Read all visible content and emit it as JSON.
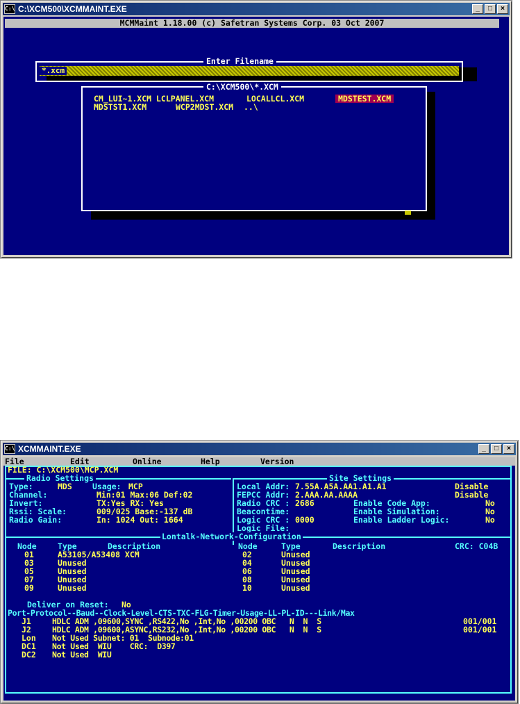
{
  "window1": {
    "title": "C:\\XCM500\\XCMMAINT.EXE",
    "icon_text": "C:\\",
    "header": "MCMMaint 1.18.00 (c) Safetran Systems Corp. 03 Oct 2007",
    "filename_dialog_title": "Enter Filename",
    "filename_input": "*.xcm",
    "filelist_title": "C:\\XCM500\\*.XCM",
    "files_row1": [
      "CM_LUI~1.XCM",
      "LCLPANEL.XCM",
      "LOCALLCL.XCM",
      "MDSTEST.XCM"
    ],
    "files_row2": [
      "MDSTST1.XCM",
      "WCP2MDST.XCM",
      "..\\"
    ]
  },
  "window2": {
    "title": "XCMMAINT.EXE",
    "icon_text": "C:\\",
    "menu": [
      "File",
      "Edit",
      "Online",
      "Help",
      "Version"
    ],
    "file_line": "FILE: C:\\XCM500\\MCP.XCM",
    "radio_title": "Radio Settings",
    "site_title": "Site Settings",
    "radio": {
      "type_label": "Type:",
      "type_value": "MDS",
      "usage_label": "Usage:",
      "usage_value": "MCP",
      "channel_label": "Channel:",
      "channel_value": "Min:01 Max:06 Def:02",
      "invert_label": "Invert:",
      "invert_value": "TX:Yes RX: Yes",
      "rssi_label": "Rssi: Scale:",
      "rssi_value": "009/025 Base:-137 dB",
      "gain_label": "Radio Gain:",
      "gain_value": "In: 1024 Out: 1664"
    },
    "site": {
      "local_label": "Local Addr:",
      "local_value": "7.55A.A5A.AA1.A1.A1",
      "local_state": "Disable",
      "fepcc_label": "FEPCC Addr:",
      "fepcc_value": "2.AAA.AA.AAAA",
      "fepcc_state": "Disable",
      "rcrc_label": "Radio CRC :",
      "rcrc_value": "2686",
      "code_label": "Enable Code App:",
      "code_value": "No",
      "beacon_label": "Beacontime:",
      "sim_label": "Enable Simulation:",
      "sim_value": "No",
      "lcrc_label": "Logic CRC :",
      "lcrc_value": "0000",
      "ladder_label": "Enable Ladder Logic:",
      "ladder_value": "No",
      "lfile_label": "Logic File:"
    },
    "lontalk_title": "Lontalk-Network-Configuration",
    "node_headers": {
      "node": "Node",
      "type": "Type",
      "description": "Description",
      "node2": "Node",
      "type2": "Type",
      "description2": "Description",
      "crc": "CRC: C04B"
    },
    "nodes_left": [
      {
        "node": "01",
        "type": "A53105/A53408 XCM"
      },
      {
        "node": "03",
        "type": "Unused"
      },
      {
        "node": "05",
        "type": "Unused"
      },
      {
        "node": "07",
        "type": "Unused"
      },
      {
        "node": "09",
        "type": "Unused"
      }
    ],
    "nodes_right": [
      {
        "node": "02",
        "type": "Unused"
      },
      {
        "node": "04",
        "type": "Unused"
      },
      {
        "node": "06",
        "type": "Unused"
      },
      {
        "node": "08",
        "type": "Unused"
      },
      {
        "node": "10",
        "type": "Unused"
      }
    ],
    "deliver_label": "Deliver on Reset:",
    "deliver_value": "No",
    "port_header": "Port-Protocol--Baud--Clock-Level-CTS-TXC-FLG-Timer-Usage-LL-PL-ID---Link/Max",
    "ports": [
      {
        "port": "J1",
        "text": "HDLC ADM ,09600,SYNC ,RS422,No ,Int,No ,00200 OBC   N  N  S",
        "link": "001/001"
      },
      {
        "port": "J2",
        "text": "HDLC ADM ,09600,ASYNC,RS232,No ,Int,No ,00200 OBC   N  N  S",
        "link": "001/001"
      },
      {
        "port": "Lon",
        "text": "Not Used Subnet: 01  Subnode:01",
        "link": ""
      },
      {
        "port": "DC1",
        "text": "Not Used  WIU    CRC:  D397",
        "link": ""
      },
      {
        "port": "DC2",
        "text": "Not Used  WIU",
        "link": ""
      }
    ]
  }
}
